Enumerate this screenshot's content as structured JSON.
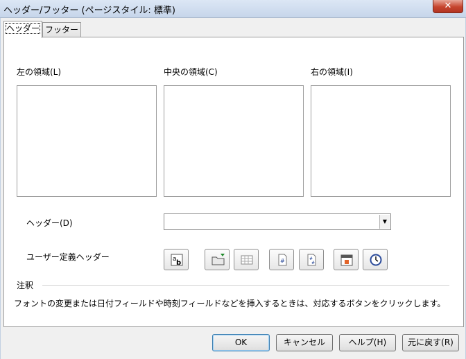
{
  "window": {
    "title": "ヘッダー/フッター (ページスタイル: 標準)",
    "close_label": "✕"
  },
  "tabs": [
    {
      "label": "ヘッダー",
      "active": true
    },
    {
      "label": "フッター",
      "active": false
    }
  ],
  "areas": {
    "left_label": "左の領域(L)",
    "center_label": "中央の領域(C)",
    "right_label": "右の領域(I)"
  },
  "header_select": {
    "label": "ヘッダー(D)",
    "value": ""
  },
  "custom_header": {
    "label": "ユーザー定義ヘッダー",
    "tools": [
      "text-attributes-icon",
      "file-name-icon",
      "sheet-name-icon",
      "page-number-icon",
      "page-count-icon",
      "date-icon",
      "time-icon"
    ]
  },
  "note": {
    "heading": "注釈",
    "text": "フォントの変更または日付フィールドや時刻フィールドなどを挿入するときは、対応するボタンをクリックします。"
  },
  "buttons": {
    "ok": "OK",
    "cancel": "キャンセル",
    "help": "ヘルプ(H)",
    "reset": "元に戻す(R)"
  }
}
